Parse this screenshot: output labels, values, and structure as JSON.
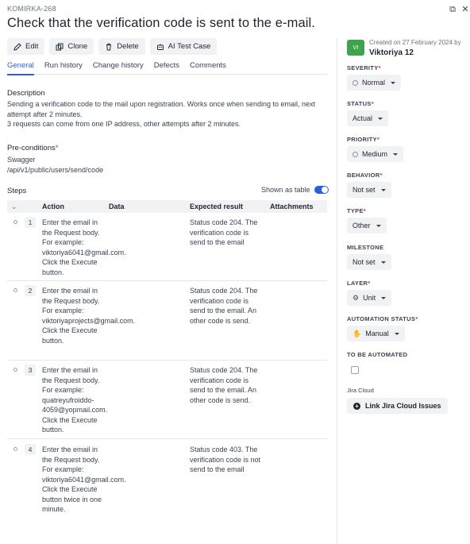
{
  "issue_key": "KOMIRKA-268",
  "title": "Check that the verification code is sent to the e-mail.",
  "toolbar": {
    "edit": "Edit",
    "clone": "Clone",
    "delete": "Delete",
    "ai": "AI Test Case"
  },
  "tabs": [
    "General",
    "Run history",
    "Change history",
    "Defects",
    "Comments"
  ],
  "description": {
    "label": "Description",
    "line1": "Sending a verification code to the mail upon registration. Works once when sending to email, next attempt after 2 minutes.",
    "line2": "3 requests can come from one IP address, other attempts after 2 minutes."
  },
  "preconditions": {
    "label": "Pre-conditions",
    "required_mark": "*",
    "line1": "Swagger",
    "line2": "/api/v1/public/users/send/code"
  },
  "steps": {
    "label": "Steps",
    "shown_as_table": "Shown as table",
    "columns": {
      "action": "Action",
      "data": "Data",
      "expected": "Expected result",
      "attachments": "Attachments"
    },
    "rows": [
      {
        "num": "1",
        "action": "Enter the email in the Request body. For example: viktoriya6041@gmail.com. Click the Execute button.",
        "expected": "Status code 204. The verification code is send to the email"
      },
      {
        "num": "2",
        "action": "Enter the email in the Request body. For example: viktoriyaprojects@gmail.com. Click the Execute button.",
        "expected": "Status code 204. The verification code is send to the email. An other code is send."
      },
      {
        "num": "3",
        "action": "Enter the email in the Request body. For example: quatreyufroiddo-4059@yopmail.com. Click the Execute button.",
        "expected": "Status code 204. The verification code is send to the email. An other code is send."
      },
      {
        "num": "4",
        "action": "Enter the email in the Request body. For example: viktoriya6041@gmail.com. Click the Execute button twice in one minute.",
        "expected": "Status code 403. The verification code is not send to the email"
      }
    ]
  },
  "sidebar": {
    "avatar_initials": "VI",
    "created": "Created on 27 February 2024 by",
    "author": "Viktoriya 12",
    "severity_label": "SEVERITY",
    "severity": "Normal",
    "status_label": "STATUS",
    "status": "Actual",
    "priority_label": "PRIORITY",
    "priority": "Medium",
    "behavior_label": "BEHAVIOR",
    "behavior": "Not set",
    "type_label": "TYPE",
    "type": "Other",
    "milestone_label": "MILESTONE",
    "milestone": "Not set",
    "layer_label": "LAYER",
    "layer": "Unit",
    "automation_label": "AUTOMATION STATUS",
    "automation": "Manual",
    "to_be_automated_label": "TO BE AUTOMATED",
    "jira_label": "Jira Cloud",
    "jira_button": "Link Jira Cloud Issues"
  },
  "colors": {
    "accent": "#2b5fd9",
    "avatar": "#3fa34d",
    "required": "#d4351c"
  }
}
